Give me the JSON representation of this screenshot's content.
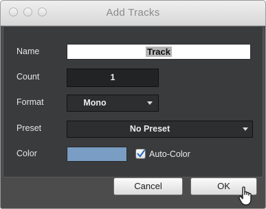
{
  "window": {
    "title": "Add Tracks"
  },
  "fields": {
    "name": {
      "label": "Name",
      "value": "Track"
    },
    "count": {
      "label": "Count",
      "value": "1"
    },
    "format": {
      "label": "Format",
      "value": "Mono"
    },
    "preset": {
      "label": "Preset",
      "value": "No Preset"
    },
    "color": {
      "label": "Color",
      "swatch": "#7a9dc4",
      "auto_color_label": "Auto-Color",
      "auto_color_checked": true
    }
  },
  "buttons": {
    "cancel": "Cancel",
    "ok": "OK"
  },
  "icons": {
    "cursor": "hand-pointer-icon",
    "checkbox": "checkmark-icon"
  }
}
